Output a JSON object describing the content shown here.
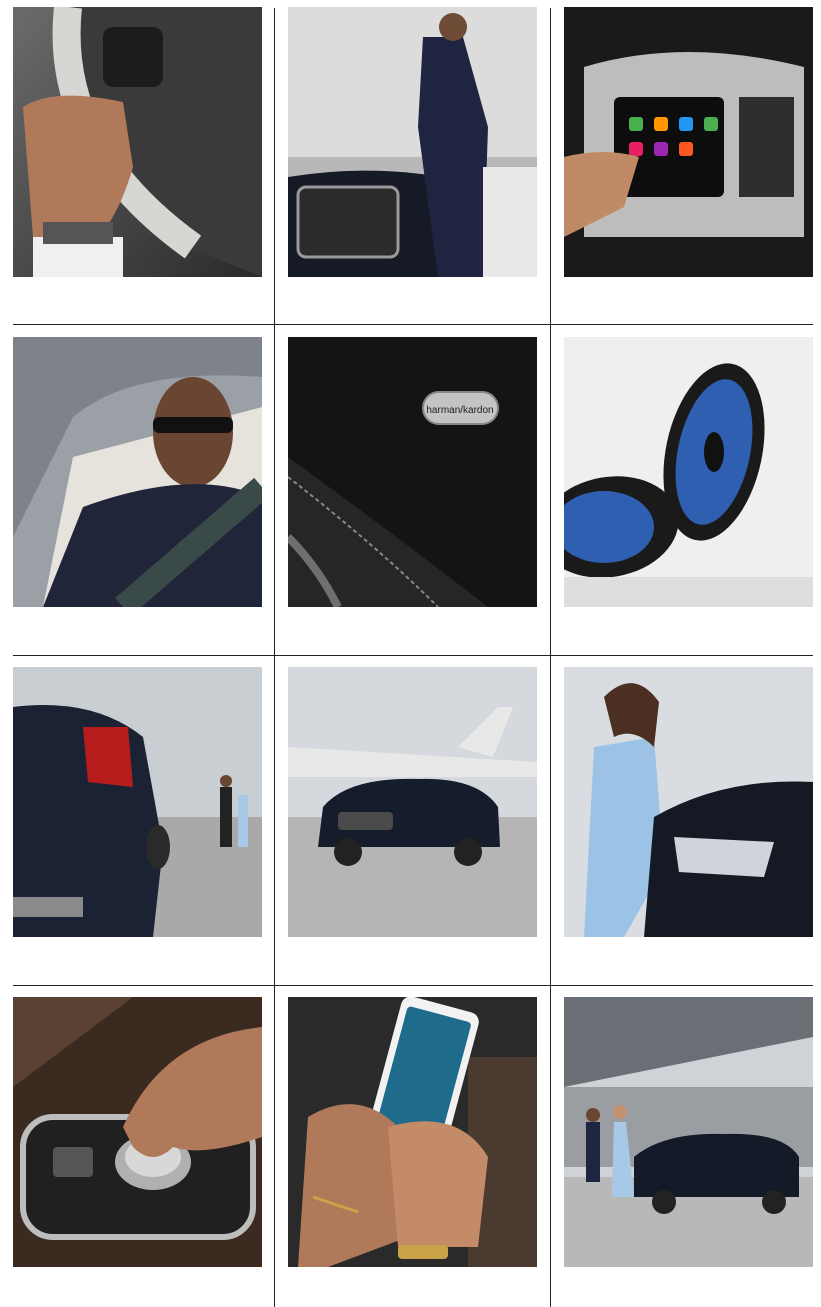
{
  "tiles": [
    {
      "id": "steering-wheel-hand"
    },
    {
      "id": "man-phone-car"
    },
    {
      "id": "touchscreen-display"
    },
    {
      "id": "man-sunglasses-driving"
    },
    {
      "id": "harman-kardon-badge",
      "badge_text": "harman/kardon"
    },
    {
      "id": "blue-speakers"
    },
    {
      "id": "rear-car-couple"
    },
    {
      "id": "car-front-jet"
    },
    {
      "id": "woman-car-headlight"
    },
    {
      "id": "rotary-dial-hand"
    },
    {
      "id": "hands-smartphone"
    },
    {
      "id": "couple-walking-car"
    }
  ]
}
